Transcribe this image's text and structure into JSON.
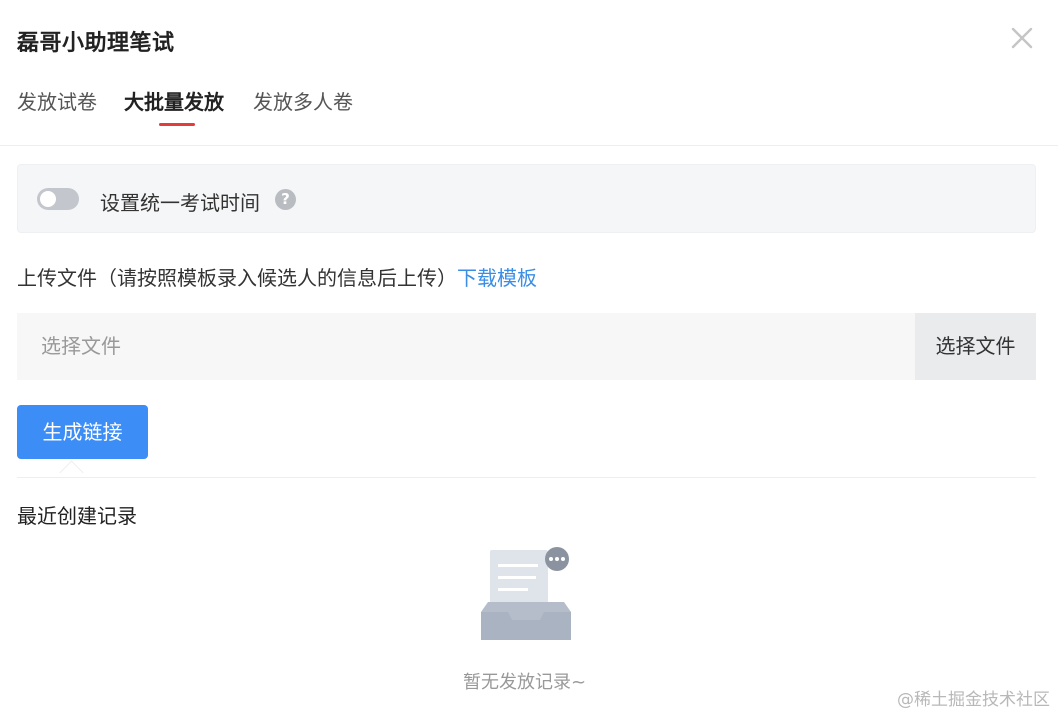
{
  "dialog": {
    "title": "磊哥小助理笔试"
  },
  "tabs": [
    {
      "label": "发放试卷",
      "active": false
    },
    {
      "label": "大批量发放",
      "active": true
    },
    {
      "label": "发放多人卷",
      "active": false
    }
  ],
  "setting": {
    "label": "设置统一考试时间",
    "toggle_on": false,
    "help": "?"
  },
  "upload": {
    "text": "上传文件（请按照模板录入候选人的信息后上传）",
    "download_link": "下载模板",
    "placeholder": "选择文件",
    "choose_button": "选择文件"
  },
  "actions": {
    "generate_button": "生成链接"
  },
  "recent": {
    "title": "最近创建记录",
    "empty_text": "暂无发放记录~"
  },
  "watermark": "@稀土掘金技术社区",
  "colors": {
    "accent_blue": "#3d8df7",
    "link_blue": "#3a8ee6",
    "tab_underline": "#e23c3c"
  }
}
